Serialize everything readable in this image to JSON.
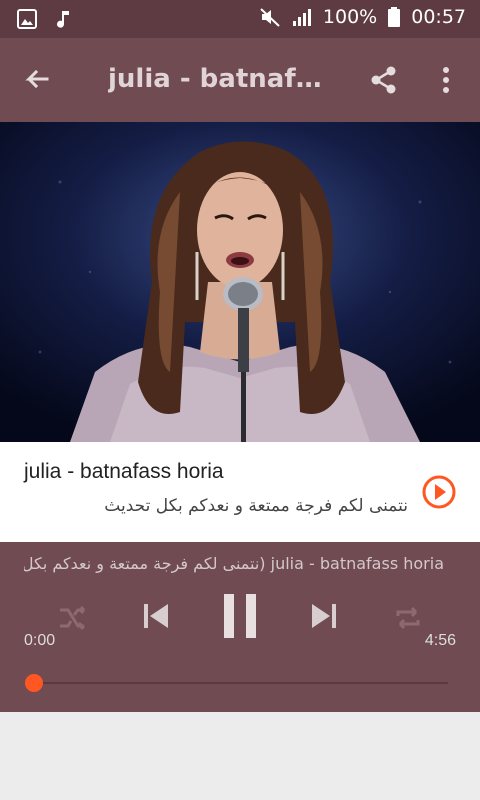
{
  "status_bar": {
    "battery": "100%",
    "time": "00:57"
  },
  "toolbar": {
    "title": "julia - batnafass horia"
  },
  "track": {
    "title": "julia - batnafass horia",
    "subtitle": "نتمنى لكم فرجة ممتعة و نعدكم بكل تحديث"
  },
  "player": {
    "marquee": "julia - batnafass horia (نتمنى لكم فرجة ممتعة و نعدكم بكل تحديث)",
    "current_time": "0:00",
    "total_time": "4:56",
    "progress": 0.0
  },
  "colors": {
    "toolbar": "#704b52",
    "status_bar": "#5e3b42",
    "accent": "#ff5722"
  },
  "icons": {
    "status_left": [
      "gallery-icon",
      "music-note-icon"
    ],
    "status_right": [
      "mute-icon",
      "signal-icon",
      "battery-icon"
    ],
    "toolbar": [
      "back-arrow-icon",
      "share-icon",
      "more-vert-icon"
    ],
    "player": [
      "shuffle-icon",
      "skip-previous-icon",
      "pause-icon",
      "skip-next-icon",
      "repeat-icon"
    ],
    "card": "play-circle-icon"
  }
}
